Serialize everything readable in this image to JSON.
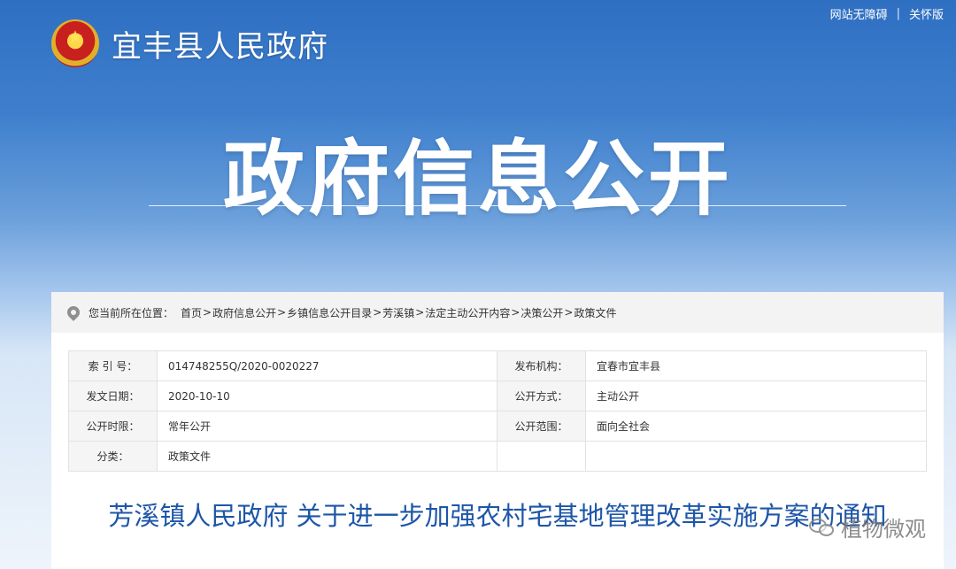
{
  "topbar": {
    "accessibility": "网站无障碍",
    "separator": "|",
    "elderly_mode": "关怀版"
  },
  "header": {
    "site_title": "宜丰县人民政府",
    "emblem_icon": "national-emblem-icon"
  },
  "hero": {
    "title": "政府信息公开"
  },
  "breadcrumb": {
    "label": "您当前所在位置：",
    "items": [
      "首页",
      "政府信息公开",
      "乡镇信息公开目录",
      "芳溪镇",
      "法定主动公开内容",
      "决策公开",
      "政策文件"
    ],
    "separator": ">"
  },
  "meta": {
    "index_no_label": "索 引 号：",
    "index_no_value": "014748255Q/2020-0020227",
    "publisher_label": "发布机构：",
    "publisher_value": "宜春市宜丰县",
    "issue_date_label": "发文日期：",
    "issue_date_value": "2020-10-10",
    "open_method_label": "公开方式：",
    "open_method_value": "主动公开",
    "open_period_label": "公开时限：",
    "open_period_value": "常年公开",
    "open_scope_label": "公开范围：",
    "open_scope_value": "面向全社会",
    "category_label": "分类：",
    "category_value": "政策文件"
  },
  "document": {
    "title": "芳溪镇人民政府 关于进一步加强农村宅基地管理改革实施方案的通知"
  },
  "watermark": {
    "text": "植物微观"
  }
}
